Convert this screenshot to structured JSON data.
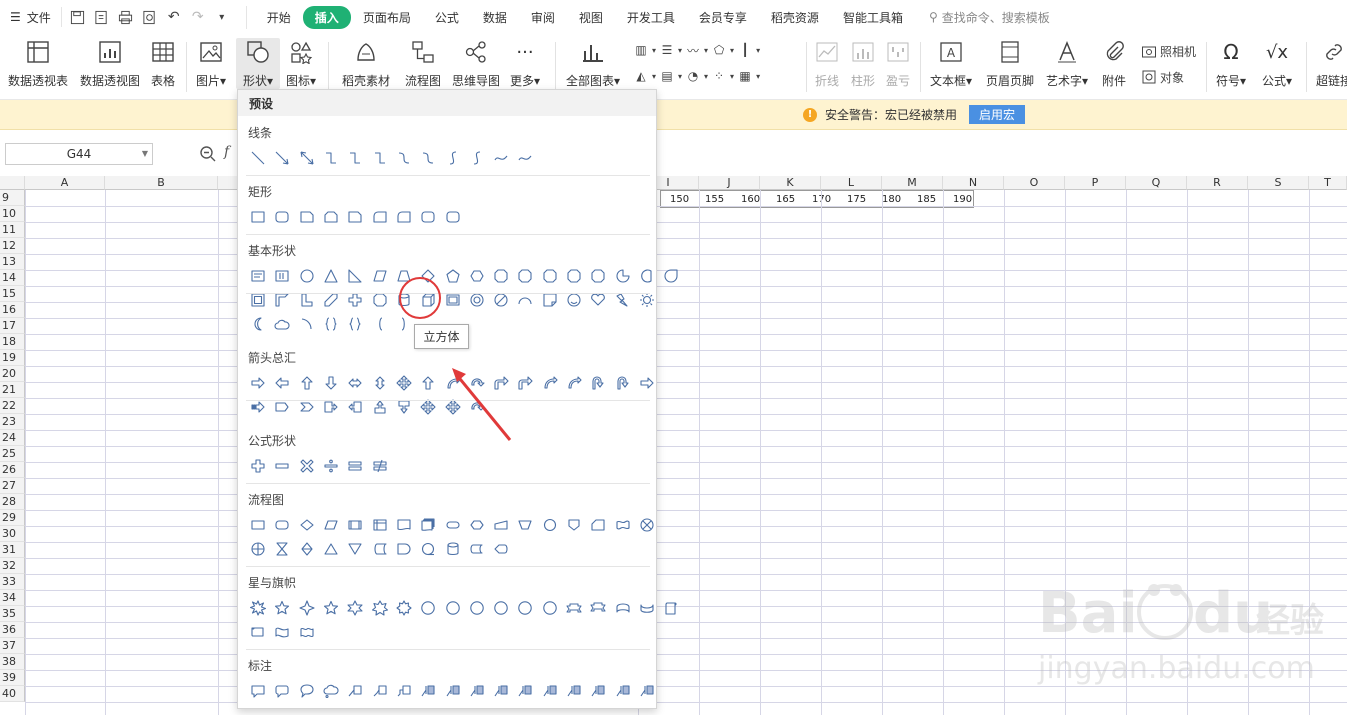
{
  "menubar": {
    "file_label": "文件",
    "tabs": [
      "开始",
      "插入",
      "页面布局",
      "公式",
      "数据",
      "审阅",
      "视图",
      "开发工具",
      "会员专享",
      "稻壳资源",
      "智能工具箱"
    ],
    "active_tab": "插入",
    "search_placeholder": "查找命令、搜索模板"
  },
  "ribbon": {
    "pivot_table": "数据透视表",
    "pivot_chart": "数据透视图",
    "table": "表格",
    "picture": "图片",
    "shape": "形状",
    "icon": "图标",
    "daoke": "稻壳素材",
    "flowchart": "流程图",
    "mindmap": "思维导图",
    "more": "更多",
    "all_charts": "全部图表",
    "line": "折线",
    "column": "柱形",
    "winloss": "盈亏",
    "textbox": "文本框",
    "header_footer": "页眉页脚",
    "wordart": "艺术字",
    "attachment": "附件",
    "camera": "照相机",
    "object": "对象",
    "symbol": "符号",
    "formula": "公式",
    "hyperlink": "超链接"
  },
  "warning": {
    "text": "安全警告：宏已经被禁用",
    "button": "启用宏"
  },
  "formula_bar": {
    "cell_ref": "G44"
  },
  "sheet": {
    "columns": [
      "A",
      "B",
      "I",
      "J",
      "K",
      "L",
      "M",
      "N",
      "O",
      "P",
      "Q",
      "R",
      "S",
      "T"
    ],
    "rows": [
      "9",
      "10",
      "11",
      "12",
      "13",
      "14",
      "15",
      "16",
      "17",
      "18",
      "19",
      "20",
      "21",
      "22",
      "23",
      "24",
      "25",
      "26",
      "27",
      "28",
      "29",
      "30",
      "31",
      "32",
      "33",
      "34",
      "35",
      "36",
      "37",
      "38",
      "39",
      "40"
    ],
    "row9_values": [
      "150",
      "155",
      "160",
      "165",
      "170",
      "175",
      "180",
      "185",
      "190"
    ]
  },
  "dropdown": {
    "header": "预设",
    "sections": [
      "线条",
      "矩形",
      "基本形状",
      "箭头总汇",
      "公式形状",
      "流程图",
      "星与旗帜",
      "标注"
    ],
    "tooltip": "立方体"
  },
  "colors": {
    "accent": "#1fb174",
    "warning_bg": "#fef3d0",
    "macro_button": "#4a90e2",
    "shape_stroke": "#4a6fa5",
    "highlight": "#e03a3a"
  }
}
